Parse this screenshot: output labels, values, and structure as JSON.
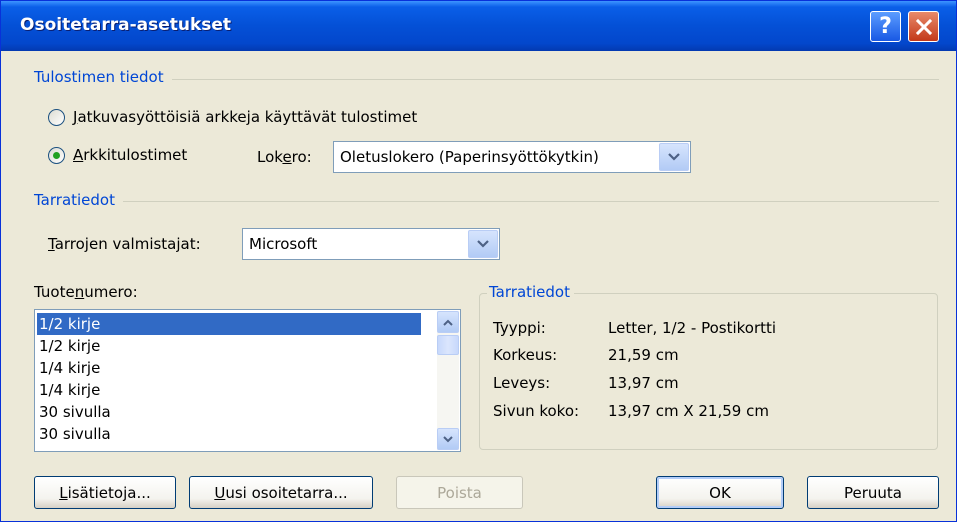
{
  "window": {
    "title": "Osoitetarra-asetukset"
  },
  "printer_info": {
    "group_label": "Tulostimen tiedot",
    "option_continuous": {
      "prefix": "",
      "key": "J",
      "rest": "atkuvasyöttöisiä arkkeja käyttävät tulostimet",
      "checked": false
    },
    "option_page": {
      "prefix": "",
      "key": "A",
      "rest": "rkkitulostimet",
      "checked": true
    },
    "tray_label": {
      "prefix": "Lok",
      "key": "e",
      "rest": "ro:"
    },
    "tray_value": "Oletuslokero (Paperinsyöttökytkin)"
  },
  "label_info": {
    "group_label": "Tarratiedot",
    "vendors_label": {
      "prefix": "",
      "key": "T",
      "rest": "arrojen valmistajat:"
    },
    "vendors_value": "Microsoft"
  },
  "product": {
    "label": {
      "prefix": "Tuote",
      "key": "n",
      "rest": "umero:"
    },
    "items": [
      "1/2 kirje",
      "1/2 kirje",
      "1/4 kirje",
      "1/4 kirje",
      "30 sivulla",
      "30 sivulla"
    ],
    "selected_index": 0
  },
  "details": {
    "group_label": "Tarratiedot",
    "rows": [
      {
        "key": "Tyyppi:",
        "value": "Letter, 1/2 - Postikortti"
      },
      {
        "key": "Korkeus:",
        "value": "21,59 cm"
      },
      {
        "key": "Leveys:",
        "value": "13,97 cm"
      },
      {
        "key": "Sivun koko:",
        "value": "13,97 cm X 21,59 cm"
      }
    ]
  },
  "buttons": {
    "details": {
      "prefix": "",
      "key": "L",
      "rest": "isätietoja..."
    },
    "new_label": {
      "prefix": "",
      "key": "U",
      "rest": "usi osoitetarra..."
    },
    "delete": "Poista",
    "ok": "OK",
    "cancel": "Peruuta"
  },
  "icons": {
    "help": "help-icon",
    "close": "close-icon",
    "dropdown": "chevron-down-icon",
    "scroll_up": "arrow-up-icon",
    "scroll_down": "arrow-down-icon"
  }
}
